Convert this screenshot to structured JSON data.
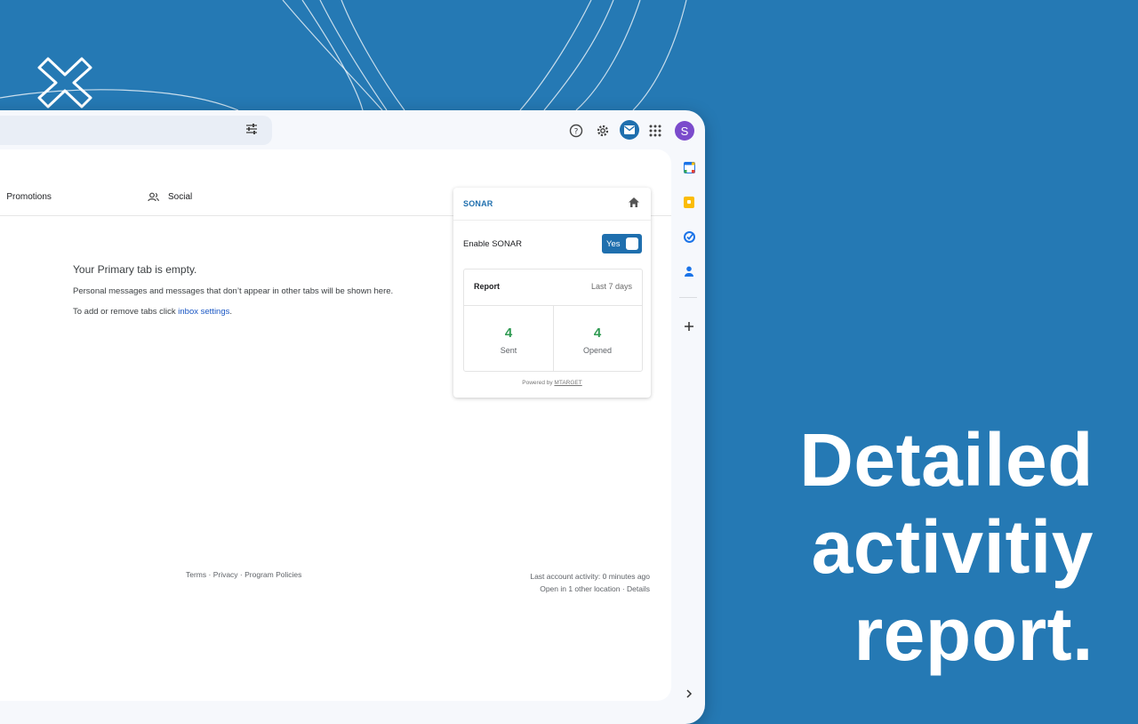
{
  "colors": {
    "background": "#2579b4",
    "brand": "#1f6fae",
    "stat_green": "#2f9a52",
    "avatar": "#7b4bcc"
  },
  "gmail": {
    "tabs": [
      {
        "label": "Promotions",
        "icon": "tag-icon"
      },
      {
        "label": "Social",
        "icon": "people-icon"
      }
    ],
    "avatar_letter": "S",
    "empty_state": {
      "title": "Your Primary tab is empty.",
      "message": "Personal messages and messages that don’t appear in other tabs will be shown here.",
      "settings_prefix": "To add or remove tabs click ",
      "settings_link": "inbox settings",
      "settings_suffix": "."
    },
    "footer": {
      "links": "Terms · Privacy · Program Policies",
      "activity": "Last account activity: 0 minutes ago",
      "location": "Open in 1 other location · Details"
    }
  },
  "sonar": {
    "brand": "SONAR",
    "enable_label": "Enable SONAR",
    "toggle_label": "Yes",
    "report": {
      "title": "Report",
      "range": "Last 7 days",
      "sent_value": "4",
      "sent_label": "Sent",
      "opened_value": "4",
      "opened_label": "Opened"
    },
    "powered_prefix": "Powered by ",
    "powered_brand": "MTARGET"
  },
  "headline": {
    "line1": "Detailed",
    "line2": "activitiy",
    "line3": "report."
  }
}
